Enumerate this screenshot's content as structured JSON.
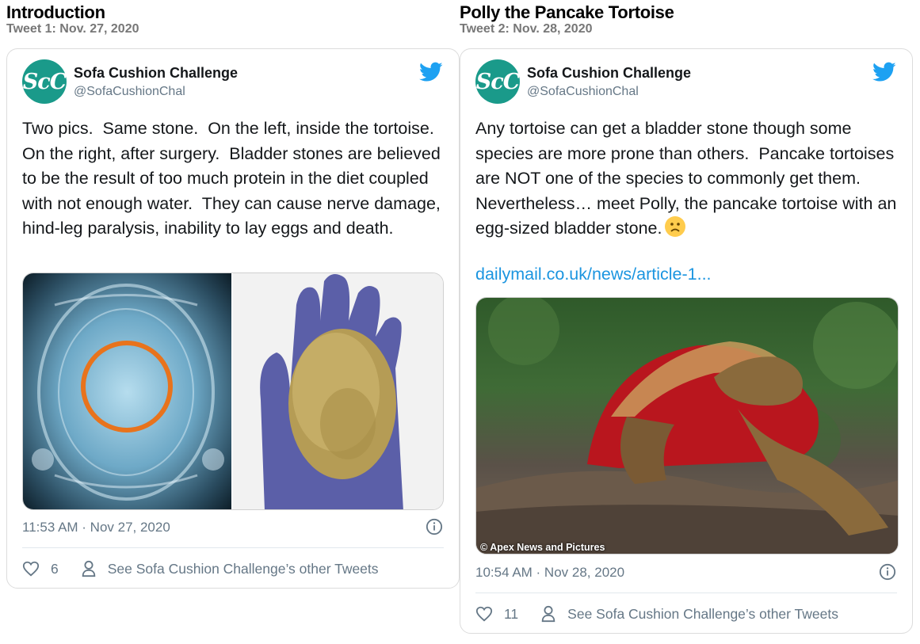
{
  "tweets": [
    {
      "section_title": "Introduction",
      "section_sub": "Tweet 1: Nov. 27, 2020",
      "avatar_text": "ScC",
      "name": "Sofa Cushion Challenge",
      "handle": "@SofaCushionChal",
      "text": "Two pics.  Same stone.  On the left, inside the tortoise.  On the right, after surgery.  Bladder stones are believed to be the result of too much protein in the diet coupled with not enough water.  They can cause nerve damage, hind-leg paralysis, inability to lay eggs and death.",
      "timestamp": "11:53 AM · Nov 27, 2020",
      "likes": "6",
      "other_tweets": "See Sofa Cushion Challenge’s other Tweets"
    },
    {
      "section_title": "Polly the Pancake Tortoise",
      "section_sub": "Tweet 2: Nov. 28, 2020",
      "avatar_text": "ScC",
      "name": "Sofa Cushion Challenge",
      "handle": "@SofaCushionChal",
      "text": "Any tortoise can get a bladder stone though some species are more prone than others.  Pancake tortoises are NOT one of the species to commonly get them.  Nevertheless… meet Polly, the pancake tortoise with an egg-sized bladder stone.",
      "link": "dailymail.co.uk/news/article-1...",
      "photo_caption": "© Apex News and Pictures",
      "timestamp": "10:54 AM · Nov 28, 2020",
      "likes": "11",
      "other_tweets": "See Sofa Cushion Challenge’s other Tweets"
    }
  ],
  "colors": {
    "avatar": "#1a9a8a",
    "twitter_blue": "#1da1f2",
    "link": "#1b95e0",
    "muted": "#657786",
    "highlight_circle": "#e8731c"
  },
  "icons": [
    "twitter-bird-icon",
    "info-icon",
    "heart-icon",
    "person-icon",
    "frown-emoji-icon"
  ]
}
